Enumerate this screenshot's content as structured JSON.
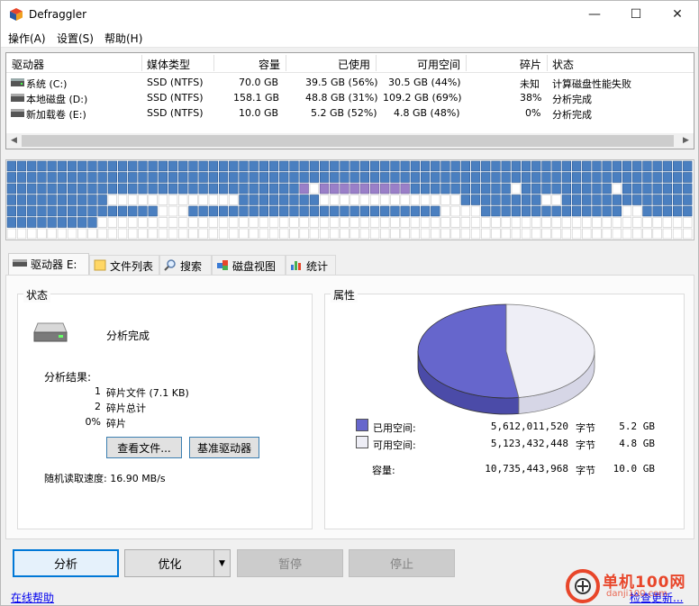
{
  "window": {
    "title": "Defraggler",
    "controls": {
      "minimize": "—",
      "maximize": "☐",
      "close": "✕"
    }
  },
  "menu": {
    "items": [
      "操作(A)",
      "设置(S)",
      "帮助(H)"
    ]
  },
  "drives": {
    "headers": [
      "驱动器",
      "媒体类型",
      "容量",
      "已使用",
      "可用空间",
      "碎片",
      "状态"
    ],
    "rows": [
      {
        "name": "系统 (C:)",
        "media": "SSD (NTFS)",
        "capacity": "70.0 GB",
        "used": "39.5 GB (56%)",
        "free": "30.5 GB (44%)",
        "frag": "未知",
        "status": "计算磁盘性能失败"
      },
      {
        "name": "本地磁盘 (D:)",
        "media": "SSD (NTFS)",
        "capacity": "158.1 GB",
        "used": "48.8 GB (31%)",
        "free": "109.2 GB (69%)",
        "frag": "38%",
        "status": "分析完成"
      },
      {
        "name": "新加载卷 (E:)",
        "media": "SSD (NTFS)",
        "capacity": "10.0 GB",
        "used": "5.2 GB (52%)",
        "free": "4.8 GB (48%)",
        "frag": "0%",
        "status": "分析完成"
      }
    ]
  },
  "tabs": [
    "驱动器 E:",
    "文件列表",
    "搜索",
    "磁盘视图",
    "统计"
  ],
  "status_group": {
    "title": "状态",
    "state": "分析完成",
    "result_label": "分析结果:",
    "results": [
      {
        "num": "1",
        "text": "碎片文件 (7.1 KB)"
      },
      {
        "num": "2",
        "text": "碎片总计"
      },
      {
        "num": "0%",
        "text": "碎片"
      }
    ],
    "view_files_button": "查看文件...",
    "benchmark_button": "基准驱动器",
    "read_speed": "随机读取速度: 16.90 MB/s"
  },
  "props_group": {
    "title": "属性",
    "used_label": "已用空间:",
    "used_bytes": "5,612,011,520",
    "used_unit": "字节",
    "used_size": "5.2 GB",
    "free_label": "可用空间:",
    "free_bytes": "5,123,432,448",
    "free_unit": "字节",
    "free_size": "4.8 GB",
    "cap_label": "容量:",
    "cap_bytes": "10,735,443,968",
    "cap_unit": "字节",
    "cap_size": "10.0 GB",
    "used_fraction": 0.5228,
    "colors": {
      "used": "#6666cc",
      "free": "#eeeef6"
    }
  },
  "bottom": {
    "analyze": "分析",
    "optimize": "优化",
    "pause": "暂停",
    "stop": "停止",
    "help_link": "在线帮助",
    "update_link": "检查更新...",
    "watermark_text": "单机100网",
    "watermark_sub": "danji100.com"
  }
}
